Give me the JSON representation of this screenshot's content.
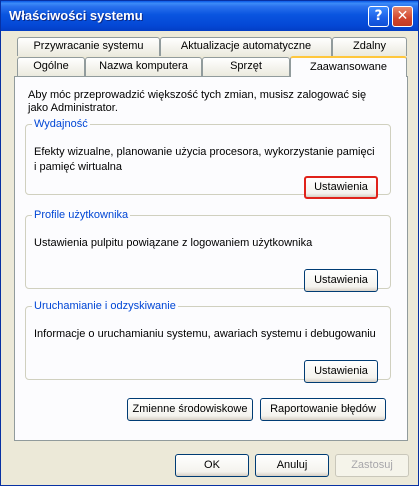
{
  "window": {
    "title": "Właściwości systemu",
    "help_label": "?",
    "close_label": "✕"
  },
  "tabs_row1": [
    "Przywracanie systemu",
    "Aktualizacje automatyczne",
    "Zdalny"
  ],
  "tabs_row2": [
    "Ogólne",
    "Nazwa komputera",
    "Sprzęt",
    "Zaawansowane"
  ],
  "active_tab": "Zaawansowane",
  "info_text": "Aby móc przeprowadzić większość tych zmian, musisz zalogować się jako Administrator.",
  "groups": {
    "performance": {
      "title": "Wydajność",
      "text": "Efekty wizualne, planowanie użycia procesora, wykorzystanie pamięci i pamięć wirtualna",
      "button": "Ustawienia"
    },
    "profile": {
      "title": "Profile użytkownika",
      "text": "Ustawienia pulpitu powiązane z logowaniem użytkownika",
      "button": "Ustawienia"
    },
    "startup": {
      "title": "Uruchamianie i odzyskiwanie",
      "text": "Informacje o uruchamianiu systemu, awariach systemu i debugowaniu",
      "button": "Ustawienia"
    }
  },
  "extra_buttons": {
    "env_vars": "Zmienne środowiskowe",
    "error_report": "Raportowanie błędów"
  },
  "footer": {
    "ok": "OK",
    "cancel": "Anuluj",
    "apply": "Zastosuj"
  }
}
